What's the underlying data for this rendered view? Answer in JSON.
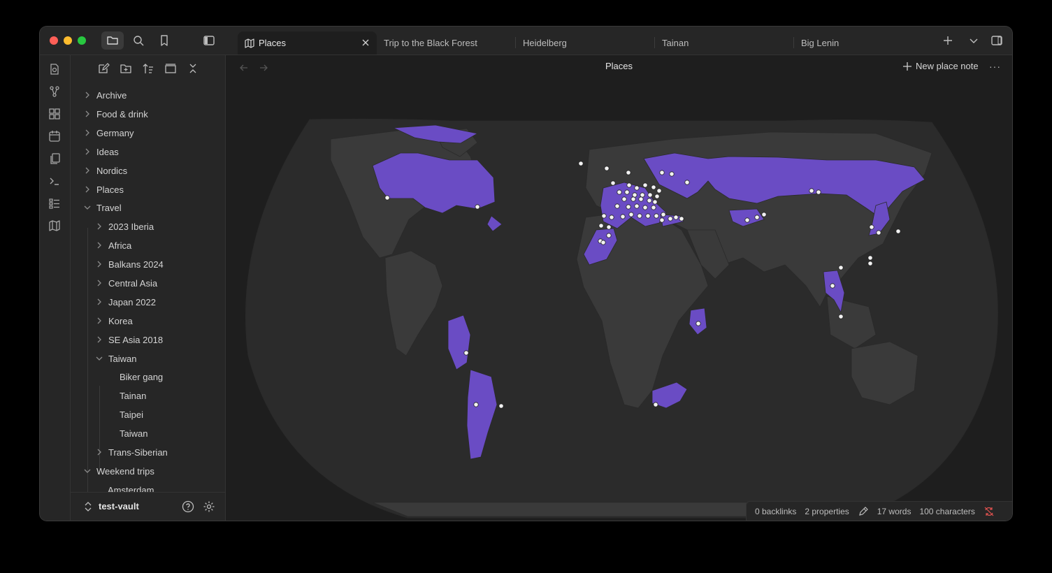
{
  "tabs": [
    {
      "label": "Places",
      "active": true
    },
    {
      "label": "Trip to the Black Forest",
      "active": false
    },
    {
      "label": "Heidelberg",
      "active": false
    },
    {
      "label": "Tainan",
      "active": false
    },
    {
      "label": "Big Lenin",
      "active": false
    }
  ],
  "icons": {
    "titlebar": [
      "folder-icon",
      "search-icon",
      "bookmark-icon",
      "sidebar-toggle-icon",
      "new-tab-icon",
      "tab-list-icon",
      "right-sidebar-toggle-icon"
    ],
    "ribbon": [
      "daily-note-icon",
      "graph-icon",
      "canvas-icon",
      "calendar-icon",
      "templates-icon",
      "command-palette-icon",
      "bases-icon",
      "map-icon"
    ],
    "sidebar_tools": [
      "new-note-icon",
      "new-folder-icon",
      "sort-icon",
      "collapse-all-icon",
      "close-all-icon"
    ]
  },
  "file_tree": {
    "top_folders": [
      "Archive",
      "Food & drink",
      "Germany",
      "Ideas",
      "Nordics",
      "Places"
    ],
    "travel": {
      "label": "Travel",
      "subfolders": [
        "2023 Iberia",
        "Africa",
        "Balkans 2024",
        "Central Asia",
        "Japan 2022",
        "Korea",
        "SE Asia 2018"
      ],
      "taiwan": {
        "label": "Taiwan",
        "notes": [
          "Biker gang",
          "Tainan",
          "Taipei",
          "Taiwan"
        ]
      },
      "after": "Trans-Siberian"
    },
    "weekend": {
      "label": "Weekend trips",
      "first_child": "Amsterdam"
    }
  },
  "vault": {
    "name": "test-vault"
  },
  "view": {
    "title": "Places",
    "new_note_label": "New place note",
    "more_label": "···"
  },
  "map": {
    "ocean_color": "#2b2b2b",
    "land_color": "#3a3a3a",
    "visited_color": "#6a4cc4",
    "marker_color": "#f2f2f2"
  },
  "status": {
    "backlinks": "0 backlinks",
    "properties": "2 properties",
    "words": "17 words",
    "characters": "100 characters"
  }
}
